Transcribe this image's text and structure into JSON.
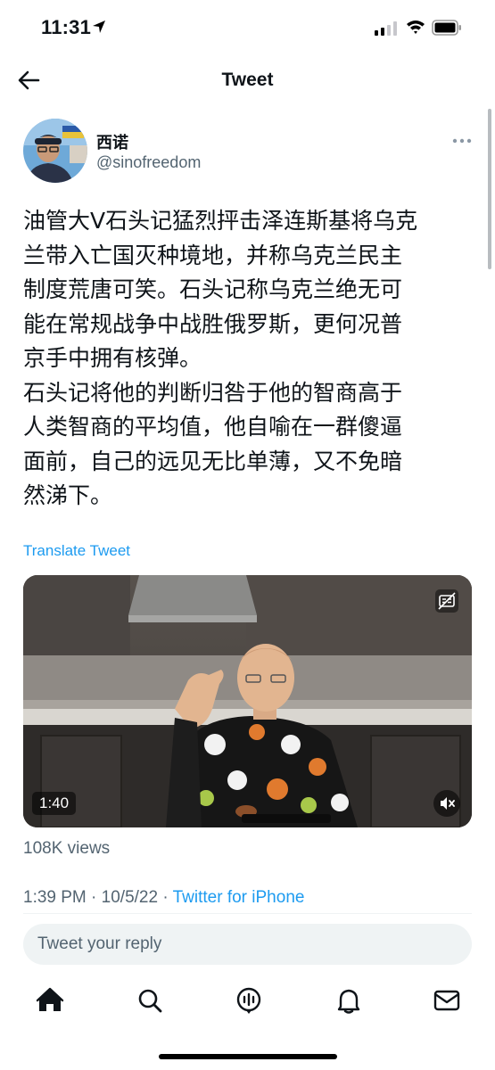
{
  "status_bar": {
    "time": "11:31"
  },
  "header": {
    "title": "Tweet"
  },
  "author": {
    "name": "西诺",
    "handle": "@sinofreedom"
  },
  "tweet": {
    "text": "油管大V石头记猛烈抨击泽连斯基将乌克\n兰带入亡国灭种境地，并称乌克兰民主\n制度荒唐可笑。石头记称乌克兰绝无可\n能在常规战争中战胜俄罗斯，更何况普\n京手中拥有核弹。\n石头记将他的判断归咎于他的智商高于\n人类智商的平均值，他自喻在一群傻逼\n面前，自己的远见无比单薄，又不免暗\n然涕下。",
    "translate_label": "Translate Tweet"
  },
  "video": {
    "duration": "1:40"
  },
  "stats": {
    "views": "108K views"
  },
  "meta": {
    "time": "1:39 PM",
    "date": "10/5/22",
    "source": "Twitter for iPhone"
  },
  "reply": {
    "placeholder": "Tweet your reply"
  },
  "tabbar": {
    "icons": [
      "home-icon",
      "search-icon",
      "spaces-icon",
      "notifications-icon",
      "messages-icon"
    ]
  },
  "colors": {
    "link": "#1d9bf0",
    "secondary_text": "#536471",
    "primary_text": "#0f1419"
  }
}
